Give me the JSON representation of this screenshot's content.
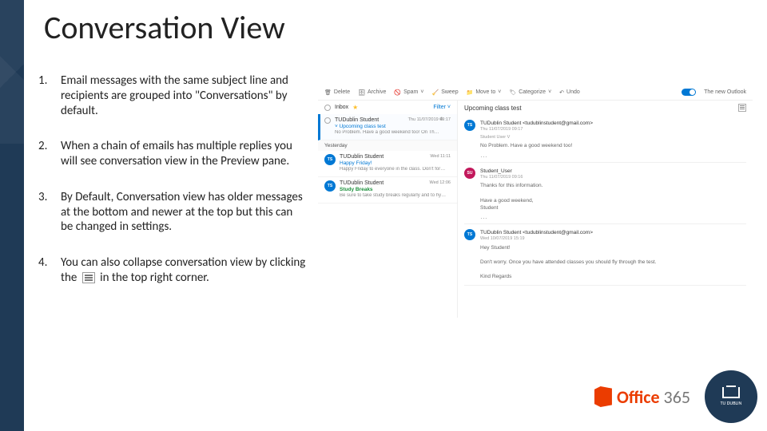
{
  "title": "Conversation View",
  "bullets": [
    "Email messages with the same subject line and recipients are grouped into \"Conversations\" by default.",
    "When a chain of emails has multiple replies you will see conversation view in the Preview pane.",
    "By Default, Conversation view has older messages at the bottom and newer at the top but this can be changed in settings.",
    {
      "pre": "You can also collapse conversation view by clicking the ",
      "post": " in the top right corner."
    }
  ],
  "shot": {
    "toolbar": {
      "delete": "Delete",
      "archive": "Archive",
      "spam": "Spam",
      "sweep": "Sweep",
      "moveto": "Move to",
      "categorize": "Categorize",
      "undo": "Undo",
      "new_outlook": "The new Outlook"
    },
    "listpane": {
      "inbox": "Inbox",
      "filter": "Filter",
      "items": [
        {
          "from": "TUDublin Student",
          "subject": "Upcoming class test",
          "preview": "No Problem. Have a good weekend too! On Th…",
          "count": "4",
          "time": "Thu 11/07/2019 09:17",
          "selected": true,
          "chevron": true
        },
        {
          "label": "Yesterday"
        },
        {
          "from": "TUDublin Student",
          "subject": "Happy Friday!",
          "preview": "Happy Friday to everyone in the class. Don't for…",
          "time": "Wed 11:11",
          "avatar": "TS"
        },
        {
          "from": "TUDublin Student",
          "subject": "Study Breaks",
          "preview": "Be sure to take study breaks regularly and to hy…",
          "time": "Wed 12:06",
          "avatar": "TS",
          "subj_style": "green"
        }
      ]
    },
    "reading": {
      "subject": "Upcoming class test",
      "thread": [
        {
          "avatar": "TS",
          "color": "blue",
          "from": "TUDublin Student <tudublinstudent@gmail.com>",
          "meta": "Thu 11/07/2019 09:17",
          "to": "Student User V",
          "body": "No Problem. Have a good weekend too!"
        },
        {
          "avatar": "SU",
          "color": "pink",
          "from": "Student_User",
          "meta": "Thu 11/07/2019 09:16",
          "to": "",
          "body": "Thanks for this information.\n\nHave a good weekend,\nStudent"
        },
        {
          "avatar": "TS",
          "color": "blue",
          "from": "TUDublin Student <tudublinstudent@gmail.com>",
          "meta": "Wed 10/07/2019 15:19",
          "to": "",
          "body": "Hey Student!\n\nDon't worry. Once you have attended classes you should fly through the test.\n\nKind Regards"
        }
      ]
    }
  },
  "footer": {
    "office_brand": "Office",
    "office_suffix": "365",
    "tudublin": "TU DUBLIN"
  }
}
